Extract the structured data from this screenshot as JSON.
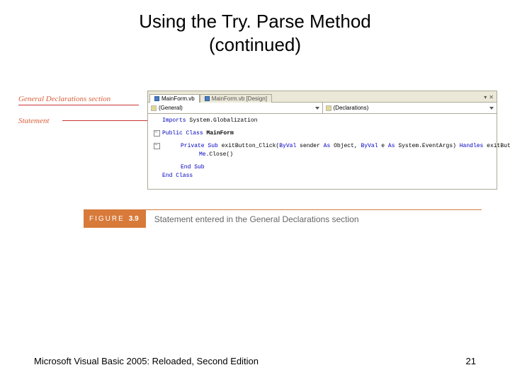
{
  "title": {
    "line1": "Using the Try. Parse Method",
    "line2": "(continued)"
  },
  "callouts": {
    "general_declarations": "General Declarations section",
    "statement": "Statement"
  },
  "ide": {
    "tabs": {
      "active": "MainForm.vb",
      "inactive": "MainForm.vb [Design]"
    },
    "dropdown_left": "(General)",
    "dropdown_right": "(Declarations)",
    "code": {
      "l1_kw": "Imports",
      "l1_rest": " System.Globalization",
      "l2_kw1": "Public",
      "l2_kw2": " Class",
      "l2_rest": " MainForm",
      "l3_kw1": "Private",
      "l3_kw2": " Sub",
      "l3_m": " exitButton_Click(",
      "l3_kw3": "ByVal",
      "l3_m2": " sender ",
      "l3_kw4": "As",
      "l3_m3": " Object, ",
      "l3_kw5": "ByVal",
      "l3_m4": " e ",
      "l3_kw6": "As",
      "l3_m5": " System.EventArgs) ",
      "l3_kw7": "Handles",
      "l3_m6": " exitButton.Click",
      "l4_kw": "Me",
      "l4_rest": ".Close()",
      "l5_kw": "End Sub",
      "l6_kw": "End Class"
    }
  },
  "figure": {
    "label": "FIGURE",
    "number": "3.9",
    "caption": "Statement entered in the General Declarations section"
  },
  "footer": {
    "book": "Microsoft Visual Basic 2005: Reloaded, Second Edition",
    "page": "21"
  }
}
